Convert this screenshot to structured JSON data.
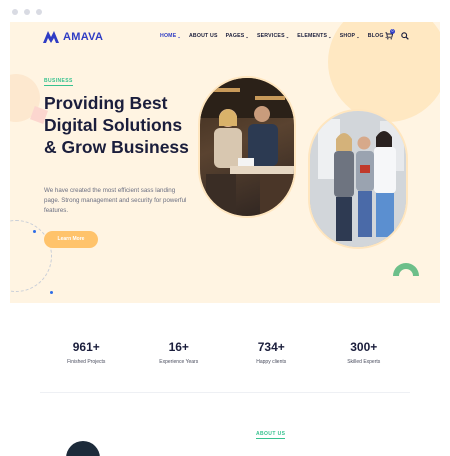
{
  "header": {
    "logo_text": "AMAVA",
    "nav": [
      {
        "label": "HOME",
        "caret": true
      },
      {
        "label": "ABOUT US",
        "caret": false
      },
      {
        "label": "PAGES",
        "caret": true
      },
      {
        "label": "SERVICES",
        "caret": true
      },
      {
        "label": "ELEMENTS",
        "caret": true
      },
      {
        "label": "SHOP",
        "caret": true
      },
      {
        "label": "BLOG",
        "caret": true
      }
    ],
    "cart_count": "0"
  },
  "hero": {
    "eyebrow": "BUSINESS",
    "title": "Providing Best Digital Solutions & Grow Business",
    "description": "We have created the most efficient sass landing page. Strong management and security for powerful features.",
    "cta_label": "Learn More"
  },
  "stats": [
    {
      "value": "961+",
      "label": "Finished Projects"
    },
    {
      "value": "16+",
      "label": "Experience Years"
    },
    {
      "value": "734+",
      "label": "Happy clients"
    },
    {
      "value": "300+",
      "label": "Skilled Experts"
    }
  ],
  "about": {
    "eyebrow": "ABOUT US"
  },
  "colors": {
    "brand": "#2f3cc4",
    "accent_green": "#37c28f",
    "button": "#ffc36b",
    "hero_bg": "#fff4e2"
  }
}
